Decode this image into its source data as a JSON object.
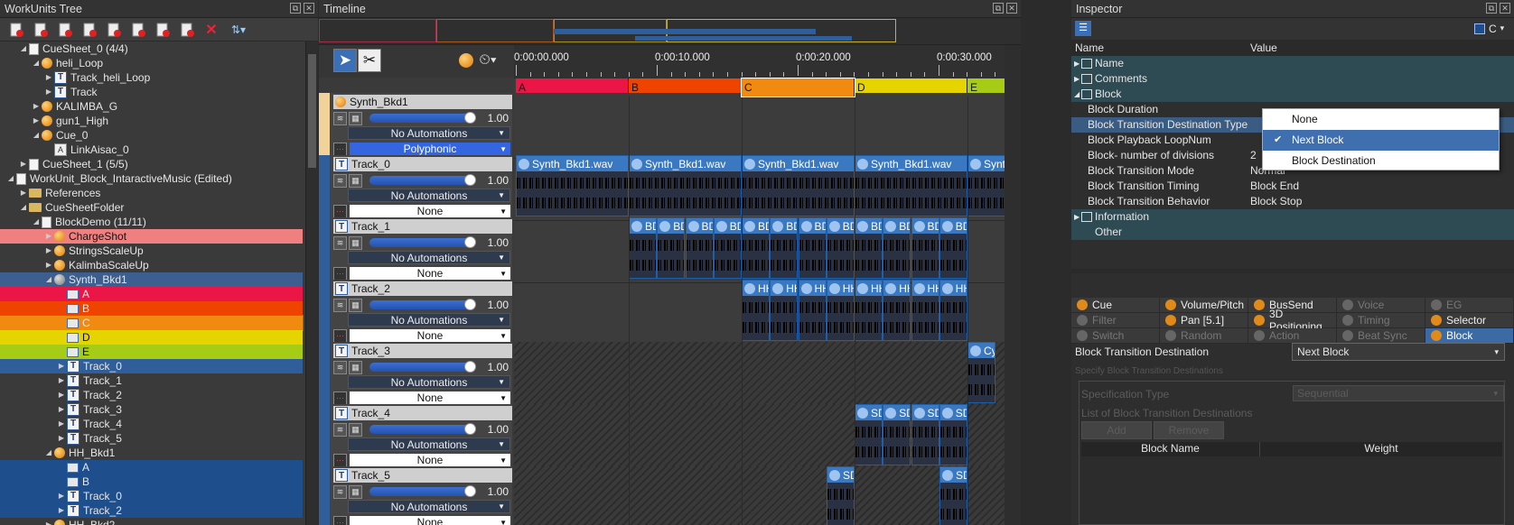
{
  "tree": {
    "title": "WorkUnits Tree",
    "items": [
      {
        "label": "CueSheet_0 (4/4)",
        "indent": 1,
        "icon": "sheet",
        "arrow": "open"
      },
      {
        "label": "heli_Loop",
        "indent": 2,
        "icon": "ball",
        "arrow": "open"
      },
      {
        "label": "Track_heli_Loop",
        "indent": 3,
        "icon": "t",
        "arrow": "closed"
      },
      {
        "label": "Track",
        "indent": 3,
        "icon": "t",
        "arrow": "closed"
      },
      {
        "label": "KALIMBA_G",
        "indent": 2,
        "icon": "ball",
        "arrow": "closed"
      },
      {
        "label": "gun1_High",
        "indent": 2,
        "icon": "ball",
        "arrow": "closed"
      },
      {
        "label": "Cue_0",
        "indent": 2,
        "icon": "ball",
        "arrow": "open"
      },
      {
        "label": "LinkAisac_0",
        "indent": 3,
        "icon": "aisac",
        "arrow": ""
      },
      {
        "label": "CueSheet_1 (5/5)",
        "indent": 1,
        "icon": "sheet",
        "arrow": "closed"
      },
      {
        "label": "WorkUnit_Block_IntaractiveMusic (Edited)",
        "indent": 0,
        "icon": "sheet",
        "arrow": "open"
      },
      {
        "label": "References",
        "indent": 1,
        "icon": "folder",
        "arrow": "closed"
      },
      {
        "label": "CueSheetFolder",
        "indent": 1,
        "icon": "folder",
        "arrow": "open"
      },
      {
        "label": "BlockDemo (11/11)",
        "indent": 2,
        "icon": "sheet",
        "arrow": "open"
      },
      {
        "label": "ChargeShot",
        "indent": 3,
        "icon": "ball",
        "arrow": "closed",
        "bg": "#f08080",
        "color": "#111"
      },
      {
        "label": "StringsScaleUp",
        "indent": 3,
        "icon": "ball",
        "arrow": "closed"
      },
      {
        "label": "KalimbaScaleUp",
        "indent": 3,
        "icon": "ball",
        "arrow": "closed"
      },
      {
        "label": "Synth_Bkd1",
        "indent": 3,
        "icon": "ballgrey",
        "arrow": "open",
        "bg": "#3d5f8f"
      },
      {
        "label": "A",
        "indent": 4,
        "icon": "block",
        "arrow": "",
        "bg": "#ec1646"
      },
      {
        "label": "B",
        "indent": 4,
        "icon": "block",
        "arrow": "",
        "bg": "#ee4400"
      },
      {
        "label": "C",
        "indent": 4,
        "icon": "block",
        "arrow": "",
        "bg": "#f08a10",
        "outline": true
      },
      {
        "label": "D",
        "indent": 4,
        "icon": "block",
        "arrow": "",
        "bg": "#e6d400",
        "color": "#111"
      },
      {
        "label": "E",
        "indent": 4,
        "icon": "block",
        "arrow": "",
        "bg": "#a6cc16",
        "color": "#111"
      },
      {
        "label": "Track_0",
        "indent": 4,
        "icon": "t",
        "arrow": "closed",
        "bg": "#2f5e9b"
      },
      {
        "label": "Track_1",
        "indent": 4,
        "icon": "t",
        "arrow": "closed"
      },
      {
        "label": "Track_2",
        "indent": 4,
        "icon": "t",
        "arrow": "closed"
      },
      {
        "label": "Track_3",
        "indent": 4,
        "icon": "t",
        "arrow": "closed"
      },
      {
        "label": "Track_4",
        "indent": 4,
        "icon": "t",
        "arrow": "closed"
      },
      {
        "label": "Track_5",
        "indent": 4,
        "icon": "t",
        "arrow": "closed"
      },
      {
        "label": "HH_Bkd1",
        "indent": 3,
        "icon": "ball",
        "arrow": "open"
      },
      {
        "label": "A",
        "indent": 4,
        "icon": "block",
        "arrow": "",
        "bg": "#1f4e8c"
      },
      {
        "label": "B",
        "indent": 4,
        "icon": "block",
        "arrow": "",
        "bg": "#1f4e8c"
      },
      {
        "label": "Track_0",
        "indent": 4,
        "icon": "t",
        "arrow": "closed",
        "bg": "#1f4e8c"
      },
      {
        "label": "Track_2",
        "indent": 4,
        "icon": "t",
        "arrow": "closed",
        "bg": "#1f4e8c"
      },
      {
        "label": "HH_Bkd2",
        "indent": 3,
        "icon": "ball",
        "arrow": "closed"
      }
    ]
  },
  "timeline": {
    "title": "Timeline",
    "ruler": [
      "0:00:00.000",
      "0:00:10.000",
      "0:00:20.000",
      "0:00:30.000"
    ],
    "blocks": [
      {
        "label": "A",
        "color": "#ec1646"
      },
      {
        "label": "B",
        "color": "#ee4400"
      },
      {
        "label": "C",
        "color": "#f08a10"
      },
      {
        "label": "D",
        "color": "#e6d400"
      },
      {
        "label": "E",
        "color": "#a6cc16"
      }
    ],
    "tracks": [
      {
        "name": "Synth_Bkd1",
        "volume": "1.00",
        "automation": "No Automations",
        "mode": "Polyphonic",
        "cue": true
      },
      {
        "name": "Track_0",
        "volume": "1.00",
        "automation": "No Automations",
        "mode": "None"
      },
      {
        "name": "Track_1",
        "volume": "1.00",
        "automation": "No Automations",
        "mode": "None"
      },
      {
        "name": "Track_2",
        "volume": "1.00",
        "automation": "No Automations",
        "mode": "None"
      },
      {
        "name": "Track_3",
        "volume": "1.00",
        "automation": "No Automations",
        "mode": "None"
      },
      {
        "name": "Track_4",
        "volume": "1.00",
        "automation": "No Automations",
        "mode": "None"
      },
      {
        "name": "Track_5",
        "volume": "1.00",
        "automation": "No Automations",
        "mode": "None"
      }
    ],
    "clip_label_long": "Synth_Bkd1.wav",
    "clip_label_cut": "Synth_",
    "clip_bd": "BD",
    "clip_hh": "HH",
    "clip_cy": "Cy",
    "clip_sd": "SD"
  },
  "inspector": {
    "title": "Inspector",
    "sort_label": "C",
    "col_name": "Name",
    "col_value": "Value",
    "rows": [
      {
        "k": "Name",
        "v": "",
        "cat": true,
        "arrow": "closed"
      },
      {
        "k": "Comments",
        "v": "",
        "cat": true,
        "arrow": "closed"
      },
      {
        "k": "Block",
        "v": "",
        "cat": true,
        "arrow": "open"
      },
      {
        "k": "Block Duration",
        "v": ""
      },
      {
        "k": "Block Transition Destination Type",
        "v": "",
        "sel": true
      },
      {
        "k": "Block Playback LoopNum",
        "v": ""
      },
      {
        "k": "Block- number of divisions",
        "v": "2"
      },
      {
        "k": "Block Transition Mode",
        "v": "Normal"
      },
      {
        "k": "Block Transition Timing",
        "v": "Block End"
      },
      {
        "k": "Block Transition Behavior",
        "v": "Block Stop"
      },
      {
        "k": "Information",
        "v": "",
        "cat": true,
        "arrow": "closed"
      },
      {
        "k": "Other",
        "v": "",
        "cat": true,
        "arrow": ""
      }
    ],
    "popup": [
      "None",
      "Next Block",
      "Block Destination"
    ],
    "popup_selected": 1,
    "tabs": [
      [
        {
          "l": "Cue",
          "d": false
        },
        {
          "l": "Volume/Pitch",
          "d": false
        },
        {
          "l": "BusSend",
          "d": false
        },
        {
          "l": "Voice",
          "d": true
        },
        {
          "l": "EG",
          "d": true
        }
      ],
      [
        {
          "l": "Filter",
          "d": true
        },
        {
          "l": "Pan [5.1]",
          "d": false
        },
        {
          "l": "3D Positioning",
          "d": false
        },
        {
          "l": "Timing",
          "d": true
        },
        {
          "l": "Selector",
          "d": false
        }
      ],
      [
        {
          "l": "Switch",
          "d": true
        },
        {
          "l": "Random",
          "d": true
        },
        {
          "l": "Action",
          "d": true
        },
        {
          "l": "Beat Sync",
          "d": true
        },
        {
          "l": "Block",
          "d": false,
          "a": true
        }
      ]
    ],
    "dest_label": "Block Transition Destination",
    "dest_value": "Next Block",
    "specify_label": "Specify Block Transition Destinations",
    "spec_type_label": "Specification Type",
    "spec_type_value": "Sequential",
    "list_label": "List of Block Transition Destinations",
    "add_label": "Add",
    "remove_label": "Remove",
    "table_cols": [
      "Block Name",
      "Weight"
    ]
  }
}
